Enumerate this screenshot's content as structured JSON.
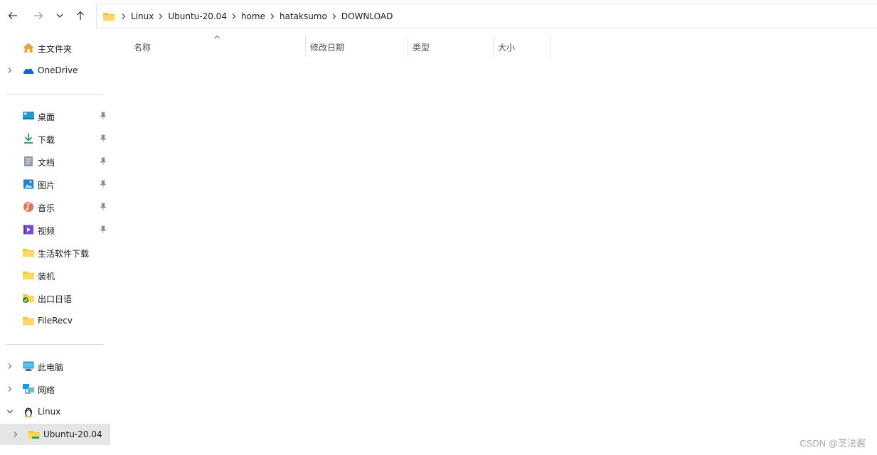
{
  "toolbar": {
    "back_icon": "arrow-left-icon",
    "forward_icon": "arrow-right-icon",
    "recent_icon": "chevron-down-icon",
    "up_icon": "arrow-up-icon"
  },
  "address_bar": {
    "breadcrumbs": [
      "Linux",
      "Ubuntu-20.04",
      "home",
      "hataksumo",
      "DOWNLOAD"
    ]
  },
  "sidebar": {
    "home": "主文件夹",
    "onedrive": "OneDrive",
    "quick_access": [
      {
        "label": "桌面",
        "icon": "desktop-icon",
        "pinned": true
      },
      {
        "label": "下载",
        "icon": "download-icon",
        "pinned": true
      },
      {
        "label": "文档",
        "icon": "document-icon",
        "pinned": true
      },
      {
        "label": "图片",
        "icon": "pictures-icon",
        "pinned": true
      },
      {
        "label": "音乐",
        "icon": "music-icon",
        "pinned": true
      },
      {
        "label": "视频",
        "icon": "video-icon",
        "pinned": true
      },
      {
        "label": "生活软件下载",
        "icon": "folder-icon",
        "pinned": false
      },
      {
        "label": "装机",
        "icon": "folder-icon",
        "pinned": false
      },
      {
        "label": "出口日语",
        "icon": "folder-synced-icon",
        "pinned": false
      },
      {
        "label": "FileRecv",
        "icon": "folder-icon",
        "pinned": false
      }
    ],
    "this_pc": "此电脑",
    "network": "网络",
    "linux": "Linux",
    "ubuntu": "Ubuntu-20.04"
  },
  "columns": {
    "name": "名称",
    "date": "修改日期",
    "type": "类型",
    "size": "大小"
  },
  "watermark": "CSDN @芝法酱",
  "colors": {
    "folder": "#f8c53a",
    "selected_bg": "#e5e5e5",
    "onedrive": "#0a64d2"
  }
}
